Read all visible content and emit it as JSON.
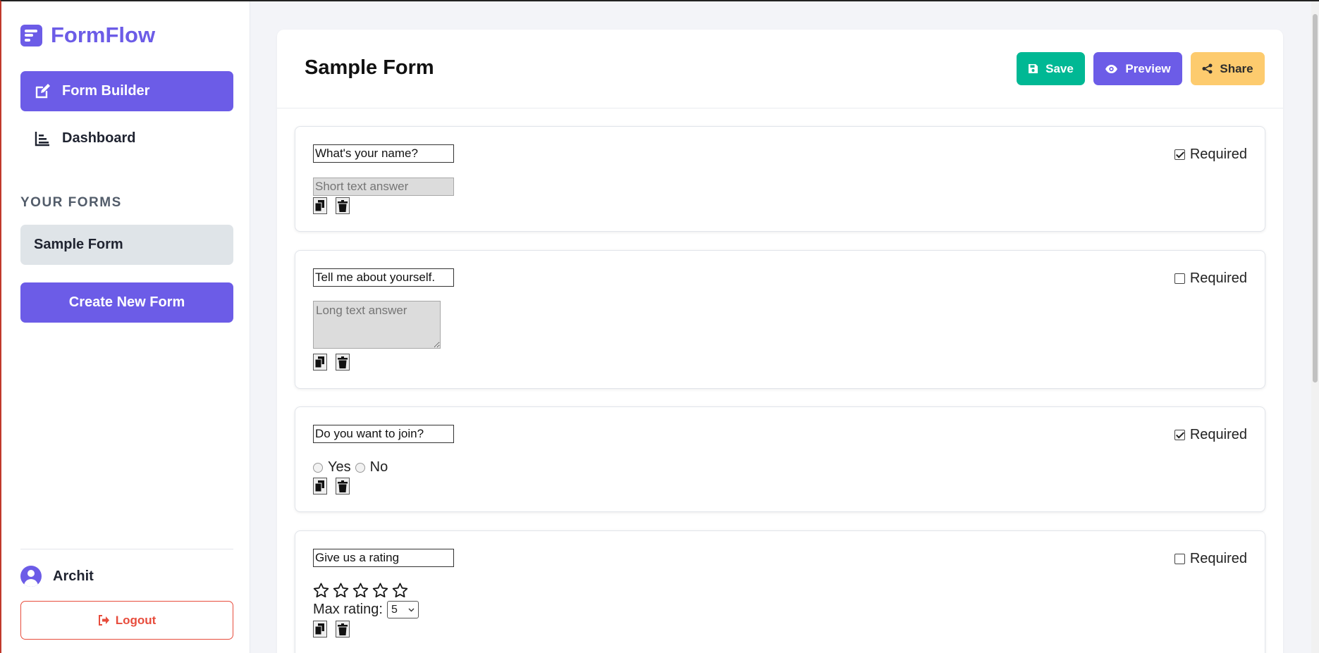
{
  "app": {
    "name": "FormFlow"
  },
  "sidebar": {
    "nav": [
      {
        "label": "Form Builder",
        "icon": "edit-icon",
        "active": true
      },
      {
        "label": "Dashboard",
        "icon": "chart-icon",
        "active": false
      }
    ],
    "section_title": "YOUR FORMS",
    "forms": [
      {
        "label": "Sample Form"
      }
    ],
    "create_label": "Create New Form",
    "user": {
      "name": "Archit"
    },
    "logout_label": "Logout"
  },
  "header": {
    "title": "Sample Form",
    "save_label": "Save",
    "preview_label": "Preview",
    "share_label": "Share"
  },
  "questions": [
    {
      "title": "What's your name?",
      "required": true,
      "required_label": "Required",
      "type": "short",
      "placeholder": "Short text answer"
    },
    {
      "title": "Tell me about yourself.",
      "required": false,
      "required_label": "Required",
      "type": "long",
      "placeholder": "Long text answer"
    },
    {
      "title": "Do you want to join?",
      "required": true,
      "required_label": "Required",
      "type": "radio",
      "options": [
        "Yes",
        "No"
      ]
    },
    {
      "title": "Give us a rating",
      "required": false,
      "required_label": "Required",
      "type": "rating",
      "stars": 5,
      "max_rating_label": "Max rating:",
      "max_rating_value": "5"
    }
  ],
  "colors": {
    "accent": "#6c5ce7",
    "save": "#00b894",
    "share": "#fdcb6e",
    "logout": "#e74c3c"
  }
}
